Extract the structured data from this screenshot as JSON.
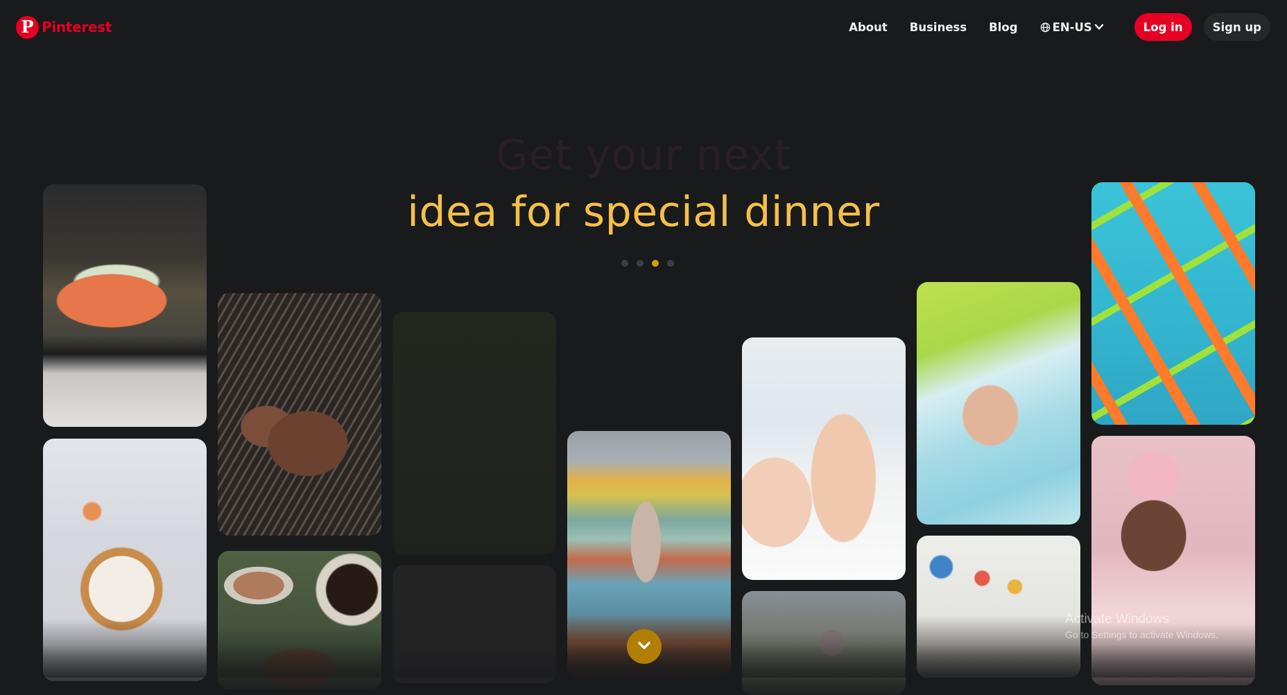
{
  "brand": {
    "name": "Pinterest",
    "mark": "P",
    "color": "#e60023"
  },
  "nav": {
    "about": "About",
    "business": "Business",
    "blog": "Blog",
    "language": "EN-US",
    "language_icon": "globe-icon",
    "login": "Log in",
    "signup": "Sign up"
  },
  "hero": {
    "line1": "Get your next",
    "line2": "idea for special dinner",
    "accent_color": "#f5c04a",
    "carousel": {
      "total": 4,
      "active_index": 3
    }
  },
  "scroll_button": {
    "icon": "chevron-down-icon",
    "color": "#b27e04"
  },
  "watermark": {
    "title": "Activate Windows",
    "subtitle": "Go to Settings to activate Windows."
  }
}
